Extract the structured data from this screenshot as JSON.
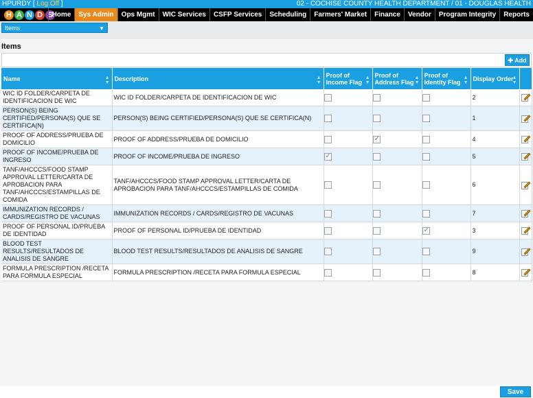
{
  "topbar": {
    "user": "HPURDY",
    "logout_label": "Log Off",
    "clinic": "02 - COCHISE COUNTY HEALTH DEPARTMENT / 01 - DOUGLAS HEALTH"
  },
  "logo": {
    "letters": [
      "H",
      "A",
      "N",
      "D",
      "S"
    ]
  },
  "nav": {
    "items": [
      "Home",
      "Sys Admin",
      "Ops Mgmt",
      "WIC Services",
      "CSFP Services",
      "Scheduling",
      "Farmers' Market",
      "Finance",
      "Vendor",
      "Program Integrity",
      "Reports"
    ],
    "active": "Sys Admin"
  },
  "subnav": {
    "selected": "Items"
  },
  "page": {
    "title": "Items",
    "add_label": "Add",
    "save_label": "Save"
  },
  "table": {
    "headers": {
      "name": "Name",
      "description": "Description",
      "income": "Proof of Income Flag",
      "address": "Proof of Address Flag",
      "identity": "Proof of Identity Flag",
      "order": "Display Order"
    },
    "rows": [
      {
        "name": "WIC ID FOLDER/CARPETA DE IDENTIFICACION DE WIC",
        "description": "WIC ID FOLDER/CARPETA DE IDENTIFICACION DE WIC",
        "income": false,
        "address": false,
        "identity": false,
        "order": "2"
      },
      {
        "name": "PERSON(S) BEING CERTIFIED/PERSONA(S) QUE SE CERTIFICA(N)",
        "description": "PERSON(S) BEING CERTIFIED/PERSONA(S) QUE SE CERTIFICA(N)",
        "income": false,
        "address": false,
        "identity": false,
        "order": "1"
      },
      {
        "name": "PROOF OF ADDRESS/PRUEBA DE DOMICILIO",
        "description": "PROOF OF ADDRESS/PRUEBA DE DOMICILIO",
        "income": false,
        "address": true,
        "identity": false,
        "order": "4"
      },
      {
        "name": "PROOF OF INCOME/PRUEBA DE INGRESO",
        "description": "PROOF OF INCOME/PRUEBA DE INGRESO",
        "income": true,
        "address": false,
        "identity": false,
        "order": "5"
      },
      {
        "name": "TANF/AHCCCS/FOOD STAMP APPROVAL LETTER/CARTA DE APROBACION PARA TANF/AHCCCS/ESTAMPILLAS DE COMIDA",
        "description": "TANF/AHCCCS/FOOD STAMP APPROVAL LETTER/CARTA DE APROBACION PARA TANF/AHCCCS/ESTAMPILLAS DE COMIDA",
        "income": false,
        "address": false,
        "identity": false,
        "order": "6"
      },
      {
        "name": "IMMUNIZATION RECORDS / CARDS/REGISTRO DE VACUNAS",
        "description": "IMMUNIZATION RECORDS / CARDS/REGISTRO DE VACUNAS",
        "income": false,
        "address": false,
        "identity": false,
        "order": "7"
      },
      {
        "name": "PROOF OF PERSONAL ID/PRUEBA DE IDENTIDAD",
        "description": "PROOF OF PERSONAL ID/PRUEBA DE IDENTIDAD",
        "income": false,
        "address": false,
        "identity": true,
        "order": "3"
      },
      {
        "name": "BLOOD TEST RESULTS/RESULTADOS DE ANALISIS DE SANGRE",
        "description": "BLOOD TEST RESULTS/RESULTADOS DE ANALISIS DE SANGRE",
        "income": false,
        "address": false,
        "identity": false,
        "order": "9"
      },
      {
        "name": "FORMULA PRESCRIPTION /RECETA PARA FORMULA ESPECIAL",
        "description": "FORMULA PRESCRIPTION /RECETA PARA FORMULA ESPECIAL",
        "income": false,
        "address": false,
        "identity": false,
        "order": "8"
      }
    ]
  },
  "colors": {
    "accent": "#1a9fe0",
    "active_tab": "#e8891d",
    "nav_bg": "#000000",
    "row_alt": "#e6f2fb"
  }
}
